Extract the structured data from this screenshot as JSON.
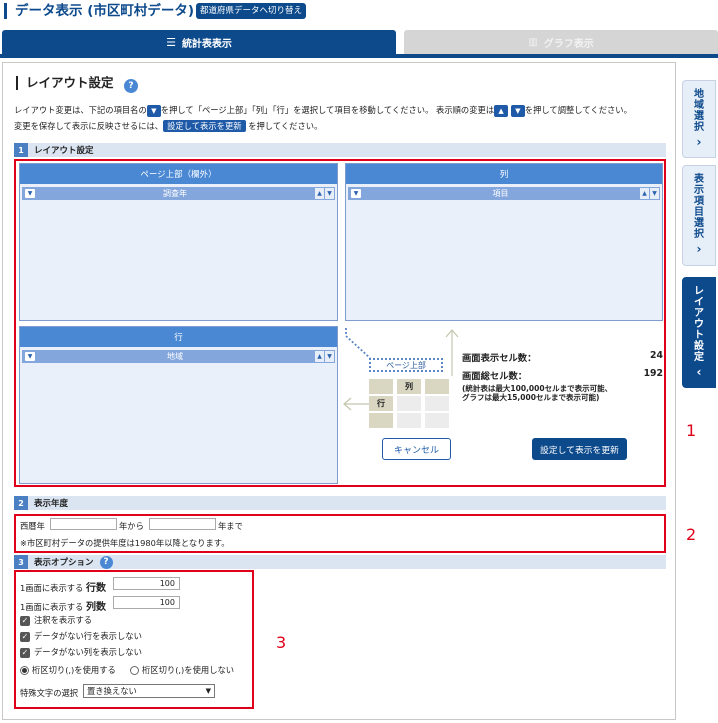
{
  "header": {
    "title": "データ表示 (市区町村データ)",
    "switch_button": "都道府県データへ切り替え"
  },
  "tabs": {
    "stats": "統計表表示",
    "graph": "グラフ表示"
  },
  "layout_section": {
    "title": "レイアウト設定",
    "help": "?",
    "desc1_a": "レイアウト変更は、下記の項目名の",
    "desc1_b": "を押して「ページ上部」「列」「行」を選択して項目を移動してください。 表示順の変更は",
    "desc1_c": "を押して調整してください。",
    "desc2_a": "変更を保存して表示に反映させるには、",
    "desc2_button": "設定して表示を更新",
    "desc2_b": "を押してください。"
  },
  "sections": [
    {
      "num": "1",
      "title": "レイアウト設定"
    },
    {
      "num": "2",
      "title": "表示年度"
    },
    {
      "num": "3",
      "title": "表示オプション"
    }
  ],
  "zones": {
    "page_top": {
      "header": "ページ上部（欄外）",
      "item": "調査年"
    },
    "column": {
      "header": "列",
      "item": "項目"
    },
    "row": {
      "header": "行",
      "item": "地域"
    }
  },
  "diagram": {
    "page_top": "ページ上部",
    "column": "列",
    "row": "行"
  },
  "cell_counts": {
    "screen_label": "画面表示セル数：",
    "screen_value": "24",
    "total_label": "画面総セル数：",
    "total_value": "192",
    "note1": "(統計表は最大100,000セルまで表示可能、",
    "note2": "グラフは最大15,000セルまで表示可能)"
  },
  "buttons": {
    "cancel": "キャンセル",
    "apply": "設定して表示を更新"
  },
  "year": {
    "era_label": "西暦年",
    "from_value": "",
    "from_suffix": "年から",
    "to_value": "",
    "to_suffix": "年まで",
    "note": "※市区町村データの提供年度は1980年以降となります。"
  },
  "options": {
    "rows_prefix": "1画面に表示する",
    "rows_label": "行数",
    "rows_value": "100",
    "cols_prefix": "1画面に表示する",
    "cols_label": "列数",
    "cols_value": "100",
    "check_annotation": "注釈を表示する",
    "check_hide_rows": "データがない行を表示しない",
    "check_hide_cols": "データがない列を表示しない",
    "radio_use_sep": "桁区切り(,)を使用する",
    "radio_no_sep": "桁区切り(,)を使用しない",
    "special_label": "特殊文字の選択",
    "special_value": "置き換えない"
  },
  "annotations": {
    "one": "1",
    "two": "2",
    "three": "3"
  },
  "side_tabs": [
    {
      "label": "地域選択",
      "chevron": "›"
    },
    {
      "label": "表示項目選択",
      "chevron": "›"
    },
    {
      "label": "レイアウト設定",
      "chevron": "‹"
    }
  ]
}
